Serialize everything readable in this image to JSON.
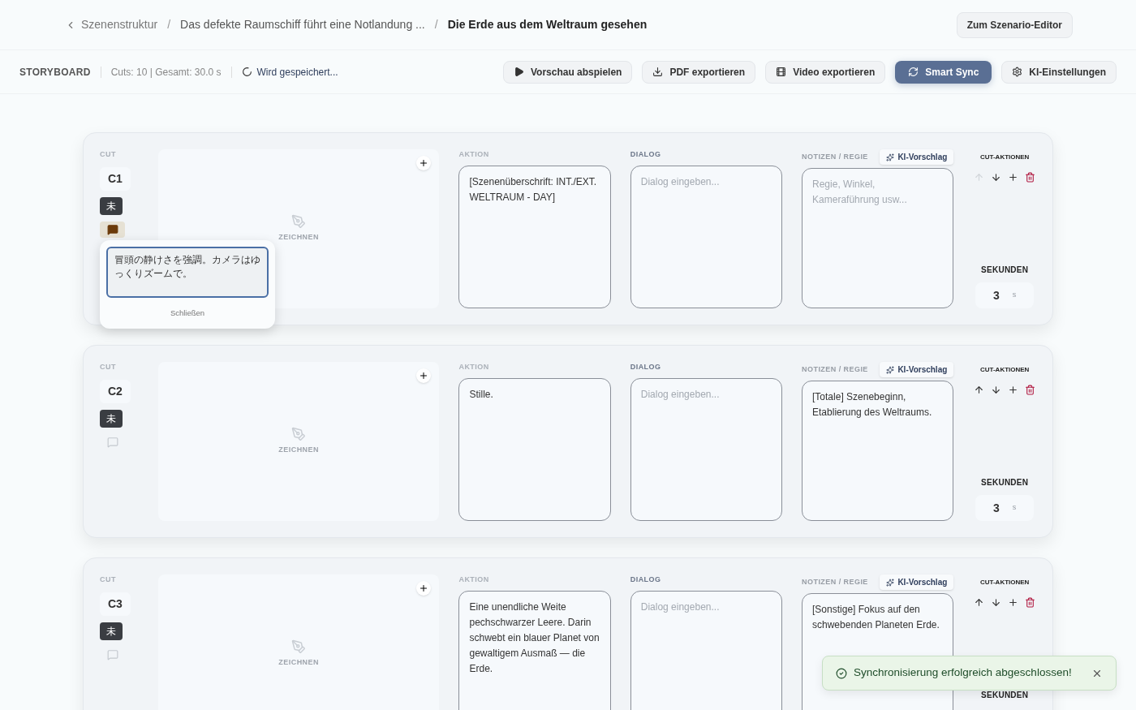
{
  "header": {
    "back": "Szenenstruktur",
    "separator": "/",
    "crumbs": [
      "Das defekte Raumschiff führt eine Notlandung ...",
      "Die Erde aus dem Weltraum gesehen"
    ],
    "editor_button": "Zum Szenario-Editor"
  },
  "toolbar": {
    "title": "STORYBOARD",
    "stats": "Cuts: 10 | Gesamt: 30.0 s",
    "status": "Wird gespeichert...",
    "buttons": [
      {
        "kind": "play",
        "label": "Vorschau abspielen",
        "selected": false
      },
      {
        "kind": "download",
        "label": "PDF exportieren",
        "selected": false
      },
      {
        "kind": "film",
        "label": "Video exportieren",
        "selected": false
      },
      {
        "kind": "sync",
        "label": "Smart Sync",
        "selected": true
      },
      {
        "kind": "settings",
        "label": "KI-Einstellungen",
        "selected": false
      }
    ]
  },
  "cuts": [
    {
      "cut_label": "CUT",
      "id": "C1",
      "badge": "未",
      "note_active": true,
      "draw_label": "ZEICHNEN",
      "action_label": "AKTION",
      "action": "[Szenenüberschrift: INT./EXT. WELTRAUM - DAY]",
      "dialog_label": "DIALOG",
      "dialog_placeholder": "Dialog eingeben...",
      "notes_label": "NOTIZEN / REGIE",
      "ai_button": "KI-Vorschlag",
      "notes_placeholder": "Regie, Winkel, Kameraführung usw...",
      "actions_label": "CUT-AKTIONEN",
      "up_disabled": true,
      "seconds_label": "SEKUNDEN",
      "seconds": "3",
      "unit": "s",
      "note_popover": {
        "text": "冒頭の静けさを強調。カメラはゆっくりズームで。",
        "close": "Schließen"
      }
    },
    {
      "cut_label": "CUT",
      "id": "C2",
      "badge": "未",
      "note_active": false,
      "draw_label": "ZEICHNEN",
      "action_label": "AKTION",
      "action": "Stille.",
      "dialog_label": "DIALOG",
      "dialog_placeholder": "Dialog eingeben...",
      "notes_label": "NOTIZEN / REGIE",
      "ai_button": "KI-Vorschlag",
      "notes": "[Totale] Szenebeginn, Etablierung des Weltraums.",
      "actions_label": "CUT-AKTIONEN",
      "up_disabled": false,
      "seconds_label": "SEKUNDEN",
      "seconds": "3",
      "unit": "s"
    },
    {
      "cut_label": "CUT",
      "id": "C3",
      "badge": "未",
      "note_active": false,
      "draw_label": "ZEICHNEN",
      "action_label": "AKTION",
      "action": "Eine unendliche Weite pechschwarzer Leere. Darin schwebt ein blauer Planet von gewaltigem Ausmaß — die Erde.",
      "dialog_label": "DIALOG",
      "dialog_placeholder": "Dialog eingeben...",
      "notes_label": "NOTIZEN / REGIE",
      "ai_button": "KI-Vorschlag",
      "notes": "[Sonstige] Fokus auf den schwebenden Planeten Erde.",
      "actions_label": "CUT-AKTIONEN",
      "up_disabled": false,
      "seconds_label": "SEKUNDEN"
    }
  ],
  "toast": {
    "text": "Synchronisierung erfolgreich abgeschlossen!"
  }
}
